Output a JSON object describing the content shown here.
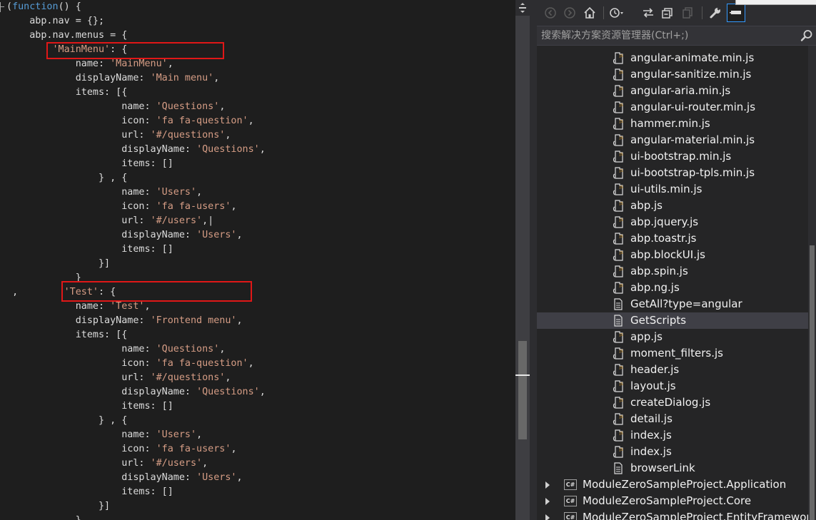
{
  "editor": {
    "lines": [
      {
        "indent": "",
        "tokens": [
          {
            "t": "(",
            "c": "plain"
          },
          {
            "t": "function",
            "c": "kw"
          },
          {
            "t": "() {",
            "c": "plain"
          }
        ],
        "fold": true
      },
      {
        "indent": "    ",
        "tokens": [
          {
            "t": "abp.nav = {};",
            "c": "plain"
          }
        ]
      },
      {
        "indent": "    ",
        "tokens": [
          {
            "t": "abp.nav.menus = {",
            "c": "plain"
          }
        ]
      },
      {
        "indent": "        ",
        "tokens": [
          {
            "t": "'MainMenu'",
            "c": "str"
          },
          {
            "t": ": {",
            "c": "plain"
          }
        ]
      },
      {
        "indent": "            ",
        "tokens": [
          {
            "t": "name: ",
            "c": "plain"
          },
          {
            "t": "'MainMenu'",
            "c": "str"
          },
          {
            "t": ",",
            "c": "plain"
          }
        ]
      },
      {
        "indent": "            ",
        "tokens": [
          {
            "t": "displayName: ",
            "c": "plain"
          },
          {
            "t": "'Main menu'",
            "c": "str"
          },
          {
            "t": ",",
            "c": "plain"
          }
        ]
      },
      {
        "indent": "            ",
        "tokens": [
          {
            "t": "items: [{",
            "c": "plain"
          }
        ]
      },
      {
        "indent": "                    ",
        "tokens": [
          {
            "t": "name: ",
            "c": "plain"
          },
          {
            "t": "'Questions'",
            "c": "str"
          },
          {
            "t": ",",
            "c": "plain"
          }
        ]
      },
      {
        "indent": "                    ",
        "tokens": [
          {
            "t": "icon: ",
            "c": "plain"
          },
          {
            "t": "'fa fa-question'",
            "c": "str"
          },
          {
            "t": ",",
            "c": "plain"
          }
        ]
      },
      {
        "indent": "                    ",
        "tokens": [
          {
            "t": "url: ",
            "c": "plain"
          },
          {
            "t": "'#/questions'",
            "c": "str"
          },
          {
            "t": ",",
            "c": "plain"
          }
        ]
      },
      {
        "indent": "                    ",
        "tokens": [
          {
            "t": "displayName: ",
            "c": "plain"
          },
          {
            "t": "'Questions'",
            "c": "str"
          },
          {
            "t": ",",
            "c": "plain"
          }
        ]
      },
      {
        "indent": "                    ",
        "tokens": [
          {
            "t": "items: []",
            "c": "plain"
          }
        ]
      },
      {
        "indent": "                ",
        "tokens": [
          {
            "t": "} , {",
            "c": "plain"
          }
        ]
      },
      {
        "indent": "                    ",
        "tokens": [
          {
            "t": "name: ",
            "c": "plain"
          },
          {
            "t": "'Users'",
            "c": "str"
          },
          {
            "t": ",",
            "c": "plain"
          }
        ]
      },
      {
        "indent": "                    ",
        "tokens": [
          {
            "t": "icon: ",
            "c": "plain"
          },
          {
            "t": "'fa fa-users'",
            "c": "str"
          },
          {
            "t": ",",
            "c": "plain"
          }
        ]
      },
      {
        "indent": "                    ",
        "tokens": [
          {
            "t": "url: ",
            "c": "plain"
          },
          {
            "t": "'#/users'",
            "c": "str"
          },
          {
            "t": ",|",
            "c": "plain"
          }
        ],
        "current": true
      },
      {
        "indent": "                    ",
        "tokens": [
          {
            "t": "displayName: ",
            "c": "plain"
          },
          {
            "t": "'Users'",
            "c": "str"
          },
          {
            "t": ",",
            "c": "plain"
          }
        ]
      },
      {
        "indent": "                    ",
        "tokens": [
          {
            "t": "items: []",
            "c": "plain"
          }
        ]
      },
      {
        "indent": "                ",
        "tokens": [
          {
            "t": "}]",
            "c": "plain"
          }
        ]
      },
      {
        "indent": "            ",
        "tokens": [
          {
            "t": "}",
            "c": "plain"
          }
        ]
      },
      {
        "indent": " ",
        "tokens": [
          {
            "t": ",        ",
            "c": "plain"
          },
          {
            "t": "'Test'",
            "c": "str"
          },
          {
            "t": ": {",
            "c": "plain"
          }
        ]
      },
      {
        "indent": "            ",
        "tokens": [
          {
            "t": "name: ",
            "c": "plain"
          },
          {
            "t": "'Test'",
            "c": "str"
          },
          {
            "t": ",",
            "c": "plain"
          }
        ]
      },
      {
        "indent": "            ",
        "tokens": [
          {
            "t": "displayName: ",
            "c": "plain"
          },
          {
            "t": "'Frontend menu'",
            "c": "str"
          },
          {
            "t": ",",
            "c": "plain"
          }
        ]
      },
      {
        "indent": "            ",
        "tokens": [
          {
            "t": "items: [{",
            "c": "plain"
          }
        ]
      },
      {
        "indent": "                    ",
        "tokens": [
          {
            "t": "name: ",
            "c": "plain"
          },
          {
            "t": "'Questions'",
            "c": "str"
          },
          {
            "t": ",",
            "c": "plain"
          }
        ]
      },
      {
        "indent": "                    ",
        "tokens": [
          {
            "t": "icon: ",
            "c": "plain"
          },
          {
            "t": "'fa fa-question'",
            "c": "str"
          },
          {
            "t": ",",
            "c": "plain"
          }
        ]
      },
      {
        "indent": "                    ",
        "tokens": [
          {
            "t": "url: ",
            "c": "plain"
          },
          {
            "t": "'#/questions'",
            "c": "str"
          },
          {
            "t": ",",
            "c": "plain"
          }
        ]
      },
      {
        "indent": "                    ",
        "tokens": [
          {
            "t": "displayName: ",
            "c": "plain"
          },
          {
            "t": "'Questions'",
            "c": "str"
          },
          {
            "t": ",",
            "c": "plain"
          }
        ]
      },
      {
        "indent": "                    ",
        "tokens": [
          {
            "t": "items: []",
            "c": "plain"
          }
        ]
      },
      {
        "indent": "                ",
        "tokens": [
          {
            "t": "} , {",
            "c": "plain"
          }
        ]
      },
      {
        "indent": "                    ",
        "tokens": [
          {
            "t": "name: ",
            "c": "plain"
          },
          {
            "t": "'Users'",
            "c": "str"
          },
          {
            "t": ",",
            "c": "plain"
          }
        ]
      },
      {
        "indent": "                    ",
        "tokens": [
          {
            "t": "icon: ",
            "c": "plain"
          },
          {
            "t": "'fa fa-users'",
            "c": "str"
          },
          {
            "t": ",",
            "c": "plain"
          }
        ]
      },
      {
        "indent": "                    ",
        "tokens": [
          {
            "t": "url: ",
            "c": "plain"
          },
          {
            "t": "'#/users'",
            "c": "str"
          },
          {
            "t": ",",
            "c": "plain"
          }
        ]
      },
      {
        "indent": "                    ",
        "tokens": [
          {
            "t": "displayName: ",
            "c": "plain"
          },
          {
            "t": "'Users'",
            "c": "str"
          },
          {
            "t": ",",
            "c": "plain"
          }
        ]
      },
      {
        "indent": "                    ",
        "tokens": [
          {
            "t": "items: []",
            "c": "plain"
          }
        ]
      },
      {
        "indent": "                ",
        "tokens": [
          {
            "t": "}]",
            "c": "plain"
          }
        ]
      },
      {
        "indent": "            ",
        "tokens": [
          {
            "t": "}",
            "c": "plain"
          }
        ]
      }
    ],
    "highlighted_keys": [
      "MainMenu",
      "Test"
    ],
    "colors": {
      "keyword": "#569cd6",
      "string": "#d69d85",
      "text": "#dcdcdc",
      "highlight_box": "#e01717"
    }
  },
  "solution_explorer": {
    "search_placeholder": "搜索解决方案资源管理器(Ctrl+;)",
    "toolbar_icons": [
      "back-icon",
      "forward-icon",
      "home-icon",
      "history-icon",
      "sync-icon",
      "collapse-all-icon",
      "copy-icon",
      "properties-wrench-icon",
      "pin-icon"
    ],
    "files": [
      {
        "name": "angular-animate.min.js",
        "type": "js"
      },
      {
        "name": "angular-sanitize.min.js",
        "type": "js"
      },
      {
        "name": "angular-aria.min.js",
        "type": "js"
      },
      {
        "name": "angular-ui-router.min.js",
        "type": "js"
      },
      {
        "name": "hammer.min.js",
        "type": "js"
      },
      {
        "name": "angular-material.min.js",
        "type": "js"
      },
      {
        "name": "ui-bootstrap.min.js",
        "type": "js"
      },
      {
        "name": "ui-bootstrap-tpls.min.js",
        "type": "js"
      },
      {
        "name": "ui-utils.min.js",
        "type": "js"
      },
      {
        "name": "abp.js",
        "type": "js"
      },
      {
        "name": "abp.jquery.js",
        "type": "js"
      },
      {
        "name": "abp.toastr.js",
        "type": "js"
      },
      {
        "name": "abp.blockUI.js",
        "type": "js"
      },
      {
        "name": "abp.spin.js",
        "type": "js"
      },
      {
        "name": "abp.ng.js",
        "type": "js"
      },
      {
        "name": "GetAll?type=angular",
        "type": "doc"
      },
      {
        "name": "GetScripts",
        "type": "doc",
        "selected": true
      },
      {
        "name": "app.js",
        "type": "js"
      },
      {
        "name": "moment_filters.js",
        "type": "js"
      },
      {
        "name": "header.js",
        "type": "js"
      },
      {
        "name": "layout.js",
        "type": "js"
      },
      {
        "name": "createDialog.js",
        "type": "js"
      },
      {
        "name": "detail.js",
        "type": "js"
      },
      {
        "name": "index.js",
        "type": "js"
      },
      {
        "name": "index.js",
        "type": "js"
      },
      {
        "name": "browserLink",
        "type": "doc"
      }
    ],
    "projects": [
      {
        "name": "ModuleZeroSampleProject.Application",
        "badge": "C#"
      },
      {
        "name": "ModuleZeroSampleProject.Core",
        "badge": "C#"
      },
      {
        "name": "ModuleZeroSampleProject.EntityFramework",
        "badge": "C#"
      }
    ],
    "colors": {
      "selected_row": "#3f3f46",
      "text": "#f1f1f1"
    }
  }
}
